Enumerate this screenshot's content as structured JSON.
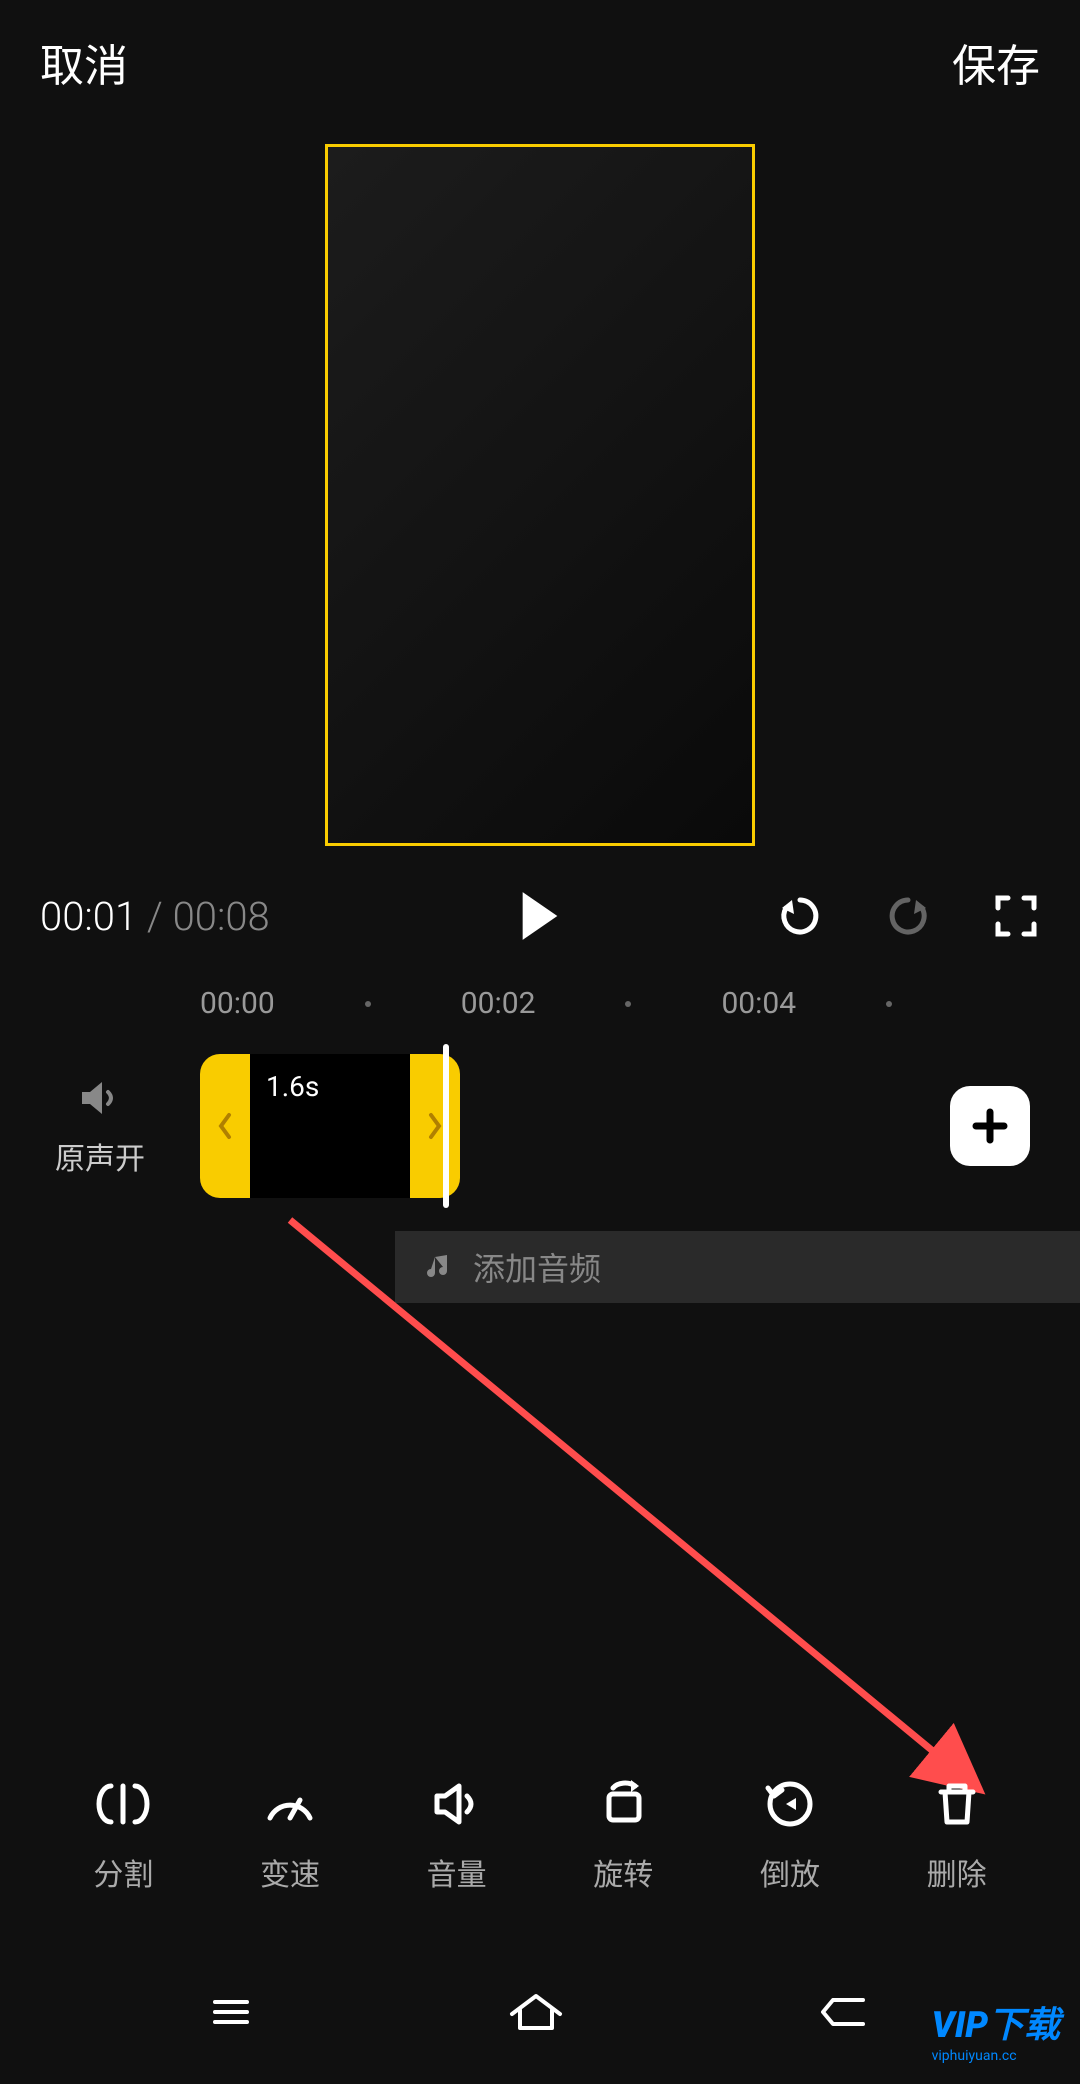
{
  "header": {
    "cancel": "取消",
    "save": "保存"
  },
  "playback": {
    "current": "00:01",
    "separator": "/",
    "total": "00:08"
  },
  "ruler": [
    "00:00",
    "00:02",
    "00:04"
  ],
  "audio": {
    "label": "原声开"
  },
  "clip": {
    "duration": "1.6s"
  },
  "audio_track": {
    "label": "添加音频"
  },
  "tools": [
    {
      "label": "分割",
      "icon": "split"
    },
    {
      "label": "变速",
      "icon": "speed"
    },
    {
      "label": "音量",
      "icon": "volume"
    },
    {
      "label": "旋转",
      "icon": "rotate"
    },
    {
      "label": "倒放",
      "icon": "reverse"
    },
    {
      "label": "删除",
      "icon": "delete"
    }
  ],
  "watermark": {
    "main": "VIP下载",
    "sub": "viphuiyuan.cc"
  },
  "colors": {
    "accent": "#f9cc00",
    "bg": "#101010",
    "arrow": "#ff4d4d"
  }
}
